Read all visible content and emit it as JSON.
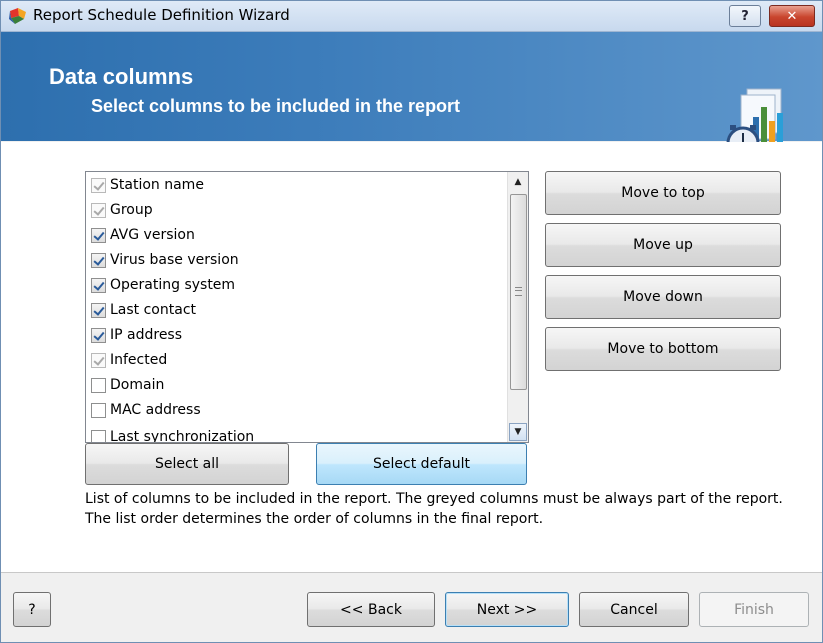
{
  "window": {
    "title": "Report Schedule Definition Wizard",
    "help_label": "?",
    "close_label": "✕"
  },
  "banner": {
    "title": "Data columns",
    "subtitle": "Select columns to be included in the report"
  },
  "columns": [
    {
      "label": "Station name",
      "state": "greyed"
    },
    {
      "label": "Group",
      "state": "greyed"
    },
    {
      "label": "AVG version",
      "state": "checked"
    },
    {
      "label": "Virus base version",
      "state": "checked"
    },
    {
      "label": "Operating system",
      "state": "checked"
    },
    {
      "label": "Last contact",
      "state": "checked"
    },
    {
      "label": "IP address",
      "state": "checked"
    },
    {
      "label": "Infected",
      "state": "greyed"
    },
    {
      "label": "Domain",
      "state": "unchecked"
    },
    {
      "label": "MAC address",
      "state": "unchecked"
    },
    {
      "label": "Last synchronization",
      "state": "unchecked"
    }
  ],
  "side_buttons": {
    "move_top": "Move to top",
    "move_up": "Move up",
    "move_down": "Move down",
    "move_bottom": "Move to bottom"
  },
  "list_buttons": {
    "select_all": "Select all",
    "select_default": "Select default"
  },
  "description": "List of columns to be included in the report. The greyed columns must be always part of the report. The list order determines the order of columns in the final report.",
  "footer": {
    "help": "?",
    "back": "<< Back",
    "next": "Next >>",
    "cancel": "Cancel",
    "finish": "Finish"
  },
  "colors": {
    "banner": "#3d7dbb",
    "accent_border": "#3c7fb1",
    "close_button": "#c9452e"
  }
}
